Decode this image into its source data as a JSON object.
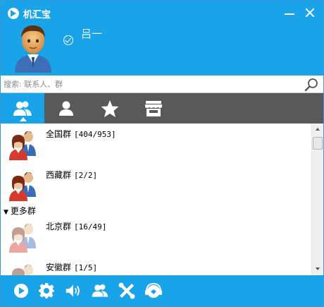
{
  "window": {
    "title": "机汇宝"
  },
  "profile": {
    "username": "吕一",
    "status": "online"
  },
  "search": {
    "placeholder": "搜索: 联系人、群"
  },
  "tabs": [
    {
      "id": "groups",
      "icon": "group-icon",
      "active": true
    },
    {
      "id": "contacts",
      "icon": "person-icon",
      "active": false
    },
    {
      "id": "favorites",
      "icon": "star-icon",
      "active": false
    },
    {
      "id": "store",
      "icon": "store-icon",
      "active": false
    }
  ],
  "groups": [
    {
      "name": "全国群",
      "count": "[404/953]"
    },
    {
      "name": "西藏群",
      "count": "[2/2]"
    }
  ],
  "more_section": {
    "label": "更多群",
    "arrow": "▼",
    "groups": [
      {
        "name": "北京群",
        "count": "[16/49]"
      },
      {
        "name": "安徽群",
        "count": "[1/5]"
      }
    ]
  },
  "toolbar": {
    "items": [
      "app-logo-icon",
      "settings-icon",
      "speaker-icon",
      "group-icon",
      "tools-icon",
      "service-icon"
    ]
  },
  "colors": {
    "accent": "#19a4ea",
    "tab_bar": "#595959"
  }
}
